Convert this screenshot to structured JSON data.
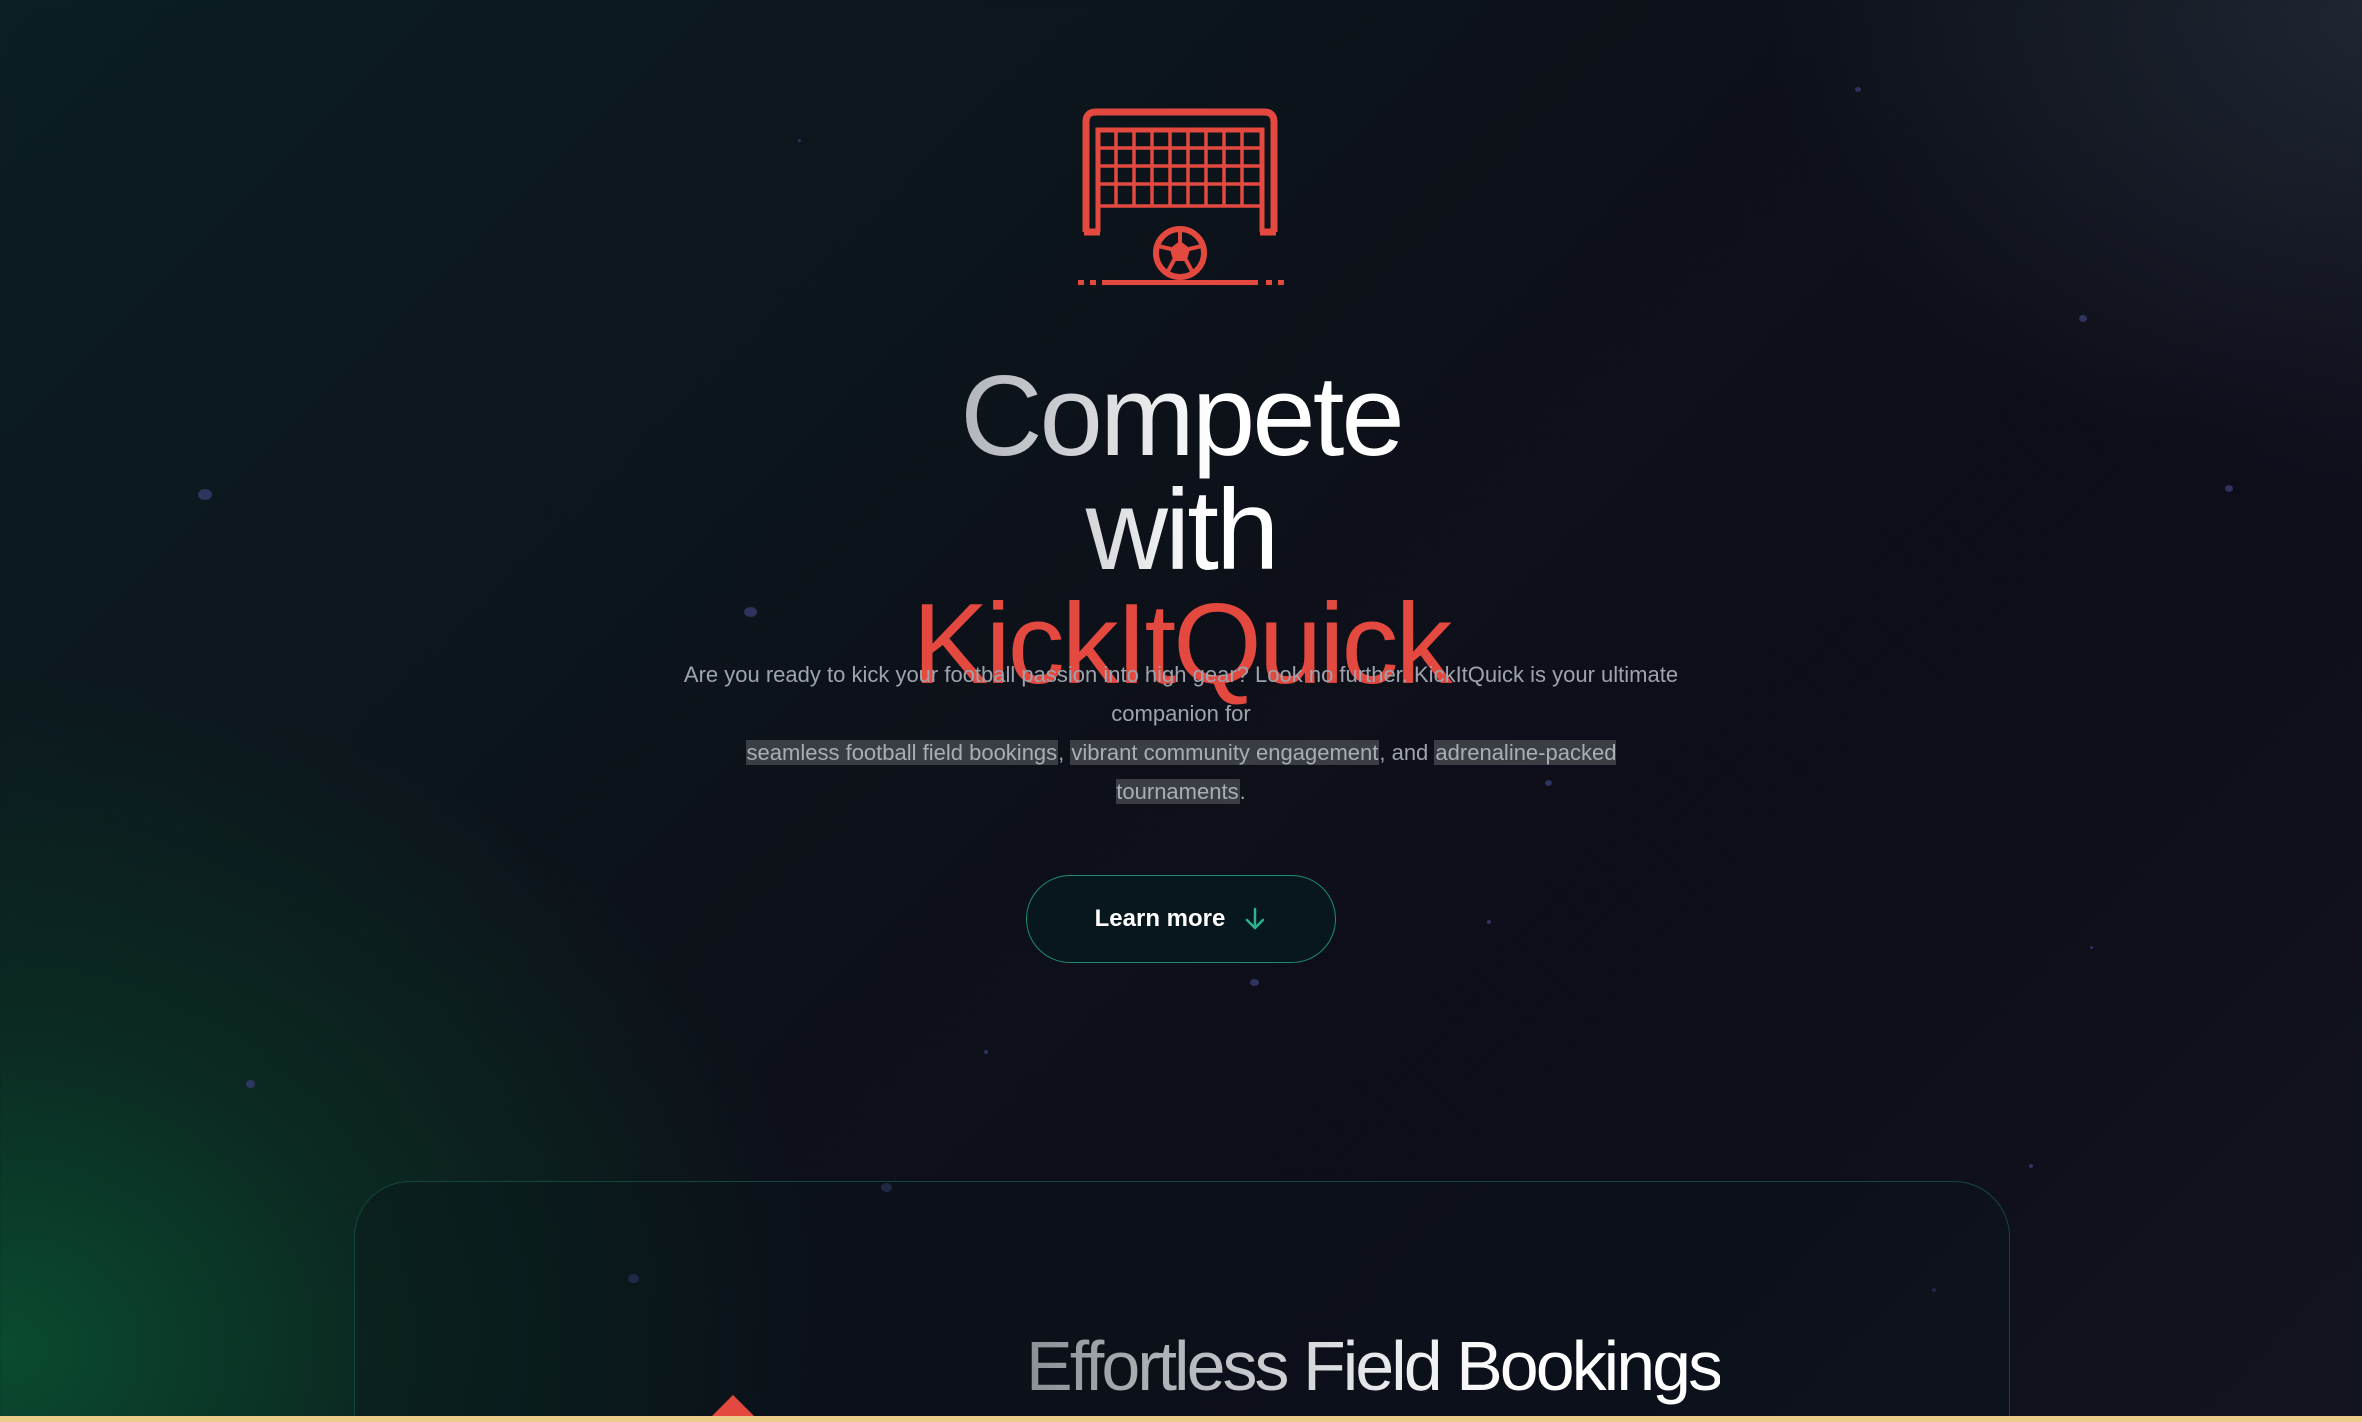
{
  "colors": {
    "accent": "#e4493f",
    "button_border": "#1d8a73",
    "arrow": "#2ab38f",
    "bottom_bar": "#eccc8a"
  },
  "hero": {
    "logo_icon": "soccer-goal-icon",
    "headline_line1": "Compete with",
    "headline_line2": "KickItQuick",
    "intro": {
      "text_before": "Are you ready to kick your football passion into high gear? Look no further. KickItQuick is your ultimate companion for",
      "highlight_1": "seamless football field bookings",
      "sep_1": ",",
      "highlight_2": "vibrant community engagement",
      "sep_2": ", and",
      "highlight_3": "adrenaline-packed tournaments",
      "end": "."
    },
    "learn_more_label": "Learn more",
    "learn_more_icon": "arrow-down-icon"
  },
  "features": {
    "first_title": "Effortless Field Bookings"
  }
}
